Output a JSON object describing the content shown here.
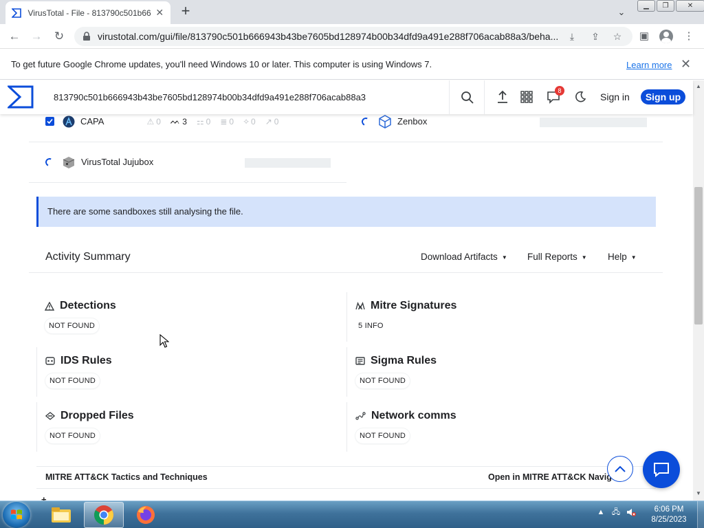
{
  "browser": {
    "tab_title": "VirusTotal - File - 813790c501b66",
    "tab_close": "✕",
    "new_tab": "+",
    "url": "virustotal.com/gui/file/813790c501b666943b43be7605bd128974b00b34dfd9a491e288f706acab88a3/beha...",
    "infobar_text": "To get future Google Chrome updates, you'll need Windows 10 or later. This computer is using Windows 7.",
    "infobar_link": "Learn more"
  },
  "vt": {
    "search_value": "813790c501b666943b43be7605bd128974b00b34dfd9a491e288f706acab88a3",
    "notification_count": "8",
    "sign_in": "Sign in",
    "sign_up": "Sign up",
    "brand_color": "#0b4dda"
  },
  "sandboxes": [
    {
      "name": "CAPA",
      "checked": true,
      "stats": [
        "0",
        "3",
        "0",
        "0",
        "0",
        "0"
      ]
    },
    {
      "name": "Zenbox",
      "status": "analysing"
    },
    {
      "name": "VirusTotal Jujubox",
      "status": "analysing"
    }
  ],
  "notice": "There are some sandboxes still analysing the file.",
  "activity": {
    "title": "Activity Summary",
    "download_artifacts": "Download Artifacts",
    "full_reports": "Full Reports",
    "help": "Help",
    "cards": [
      {
        "title": "Detections",
        "value": "NOT FOUND",
        "icon": "warning-icon"
      },
      {
        "title": "Mitre Signatures",
        "value": "5 INFO",
        "icon": "mitre-icon"
      },
      {
        "title": "IDS Rules",
        "value": "NOT FOUND",
        "icon": "ids-icon"
      },
      {
        "title": "Sigma Rules",
        "value": "NOT FOUND",
        "icon": "sigma-icon"
      },
      {
        "title": "Dropped Files",
        "value": "NOT FOUND",
        "icon": "dropped-files-icon"
      },
      {
        "title": "Network comms",
        "value": "NOT FOUND",
        "icon": "network-icon"
      }
    ]
  },
  "mitre": {
    "title": "MITRE ATT&CK Tactics and Techniques",
    "link": "Open in MITRE ATT&CK Navigator"
  },
  "taskbar": {
    "time": "6:06 PM",
    "date": "8/25/2023"
  }
}
